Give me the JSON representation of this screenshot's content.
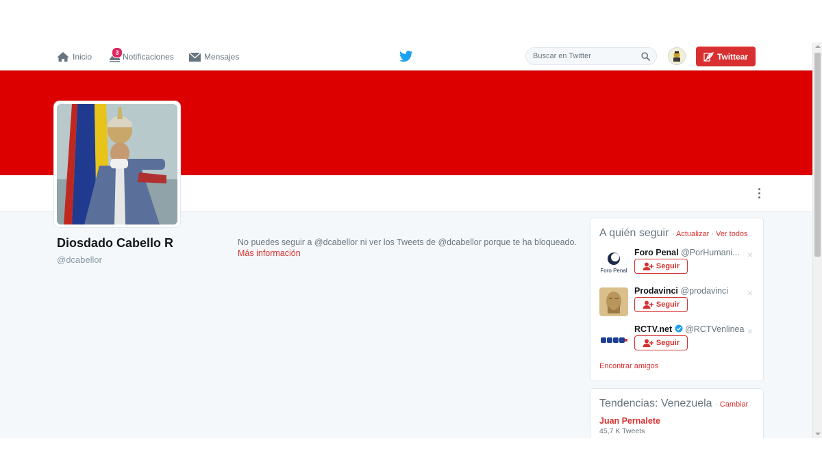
{
  "nav": {
    "home_label": "Inicio",
    "notifications_label": "Notificaciones",
    "notifications_count": "3",
    "messages_label": "Mensajes"
  },
  "search": {
    "placeholder": "Buscar en Twitter"
  },
  "tweet_button_label": "Twittear",
  "profile": {
    "name": "Diosdado Cabello R",
    "handle": "@dcabellor",
    "blocked_message": "No puedes seguir a @dcabellor ni ver los Tweets de @dcabellor porque te ha bloqueado.",
    "more_info_label": "Más información"
  },
  "who_to_follow": {
    "title": "A quién seguir",
    "refresh_label": "Actualizar",
    "view_all_label": "Ver todos",
    "separator": "·",
    "suggestions": [
      {
        "name": "Foro Penal",
        "handle": "@PorHumani...",
        "follow_label": "Seguir",
        "close": "×",
        "avatar_text": "Foro Penal"
      },
      {
        "name": "Prodavinci",
        "handle": "@prodavinci",
        "follow_label": "Seguir",
        "close": "×"
      },
      {
        "name": "RCTV.net",
        "handle": "@RCTVenlinea",
        "follow_label": "Seguir",
        "close": "×",
        "verified": true
      }
    ],
    "find_friends_label": "Encontrar amigos"
  },
  "trends": {
    "title": "Tendencias: Venezuela",
    "change_label": "Cambiar",
    "separator": "·",
    "items": [
      {
        "name": "Juan Pernalete",
        "count": "45,7 K Tweets"
      }
    ]
  },
  "colors": {
    "banner": "#dd0000",
    "accent": "#d83030",
    "twitter_blue": "#1da1f2",
    "page_bg": "#f5f8fa"
  },
  "icons": {
    "home": "home-icon",
    "notifications": "bell-icon",
    "messages": "envelope-icon",
    "logo": "twitter-bird-icon",
    "search": "magnifier-icon",
    "tweet": "quill-icon",
    "follow": "person-add-icon",
    "more": "kebab-icon",
    "verified": "verified-badge-icon"
  }
}
